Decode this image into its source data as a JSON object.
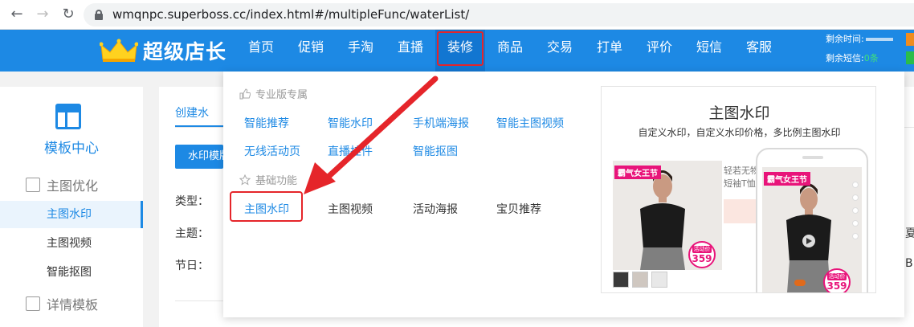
{
  "browser": {
    "url": "wmqnpc.superboss.cc/index.html#/multipleFunc/waterList/",
    "back_icon": "arrow-left-icon",
    "forward_icon": "arrow-right-icon",
    "reload_icon": "reload-icon"
  },
  "header": {
    "logo_text": "超级店长",
    "menu": [
      "首页",
      "促销",
      "手淘",
      "直播",
      "装修",
      "商品",
      "交易",
      "打单",
      "评价",
      "短信",
      "客服"
    ],
    "active_menu": "装修",
    "remain_time_label": "剩余时间:",
    "remain_sms_label": "剩余短信:",
    "remain_sms_value": "0条",
    "colors": {
      "bar": "#1d89e4",
      "highlight": "#e5252a"
    }
  },
  "sidebar": {
    "title": "模板中心",
    "group1": "主图优化",
    "items": [
      "主图水印",
      "主图视频",
      "智能抠图"
    ],
    "active_item": "主图水印",
    "group2": "详情模板"
  },
  "main": {
    "tab_label": "创建水",
    "button_label": "水印模版",
    "labels": [
      "类型：",
      "主题：",
      "节日："
    ],
    "edge_chars": [
      "夏",
      "B"
    ]
  },
  "dropdown": {
    "pro_section": "专业版专属",
    "pro_row1": [
      "智能推荐",
      "智能水印",
      "手机端海报",
      "智能主图视频"
    ],
    "pro_row2": [
      "无线活动页",
      "直播挂件",
      "智能抠图"
    ],
    "basic_section": "基础功能",
    "basic_items": [
      "主图水印",
      "主图视频",
      "活动海报",
      "宝贝推荐"
    ],
    "preview": {
      "title": "主图水印",
      "subtitle": "自定义水印，自定义水印价格，多比例主图水印",
      "tag": "霸气女王节",
      "price_label": "活动价",
      "price": "359",
      "side_text1": "轻若无物",
      "side_text2": "短袖T恤"
    }
  }
}
